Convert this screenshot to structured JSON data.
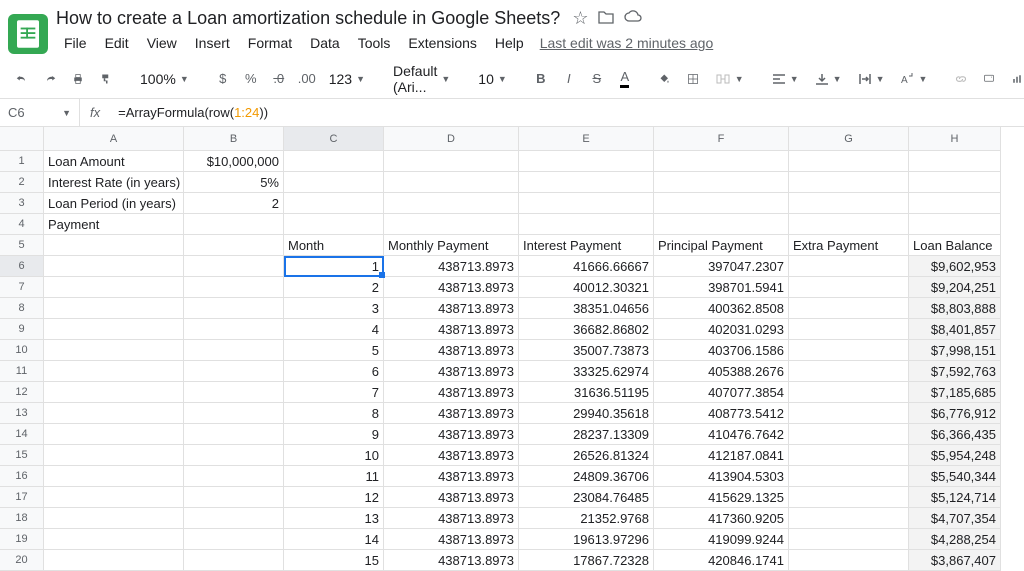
{
  "doc_title": "How to create a Loan amortization schedule in Google Sheets?",
  "menu": [
    "File",
    "Edit",
    "View",
    "Insert",
    "Format",
    "Data",
    "Tools",
    "Extensions",
    "Help"
  ],
  "last_edit": "Last edit was 2 minutes ago",
  "toolbar": {
    "zoom": "100%",
    "currency": "$",
    "percent": "%",
    "dec_dec": ".0",
    "inc_dec": ".00",
    "more_fmt": "123",
    "font": "Default (Ari...",
    "font_size": "10"
  },
  "name_box": "C6",
  "formula": {
    "prefix": "=ArrayFormula(row(",
    "range": "1:24",
    "suffix": "))"
  },
  "cols": [
    "A",
    "B",
    "C",
    "D",
    "E",
    "F",
    "G",
    "H"
  ],
  "rows": [
    {
      "n": "1",
      "A": "Loan Amount",
      "B": "$10,000,000",
      "Br": true
    },
    {
      "n": "2",
      "A": "Interest Rate (in years)",
      "B": "5%",
      "Br": true
    },
    {
      "n": "3",
      "A": "Loan Period (in years)",
      "B": "2",
      "Br": true
    },
    {
      "n": "4",
      "A": "Payment"
    },
    {
      "n": "5",
      "C": "Month",
      "D": "Monthly Payment",
      "E": "Interest Payment",
      "F": "Principal Payment",
      "G": "Extra Payment",
      "H": "Loan Balance"
    },
    {
      "n": "6",
      "C": "1",
      "D": "438713.8973",
      "E": "41666.66667",
      "F": "397047.2307",
      "H": "$9,602,953",
      "sel": true,
      "shade": true
    },
    {
      "n": "7",
      "C": "2",
      "D": "438713.8973",
      "E": "40012.30321",
      "F": "398701.5941",
      "H": "$9,204,251",
      "shade": true
    },
    {
      "n": "8",
      "C": "3",
      "D": "438713.8973",
      "E": "38351.04656",
      "F": "400362.8508",
      "H": "$8,803,888",
      "shade": true
    },
    {
      "n": "9",
      "C": "4",
      "D": "438713.8973",
      "E": "36682.86802",
      "F": "402031.0293",
      "H": "$8,401,857",
      "shade": true
    },
    {
      "n": "10",
      "C": "5",
      "D": "438713.8973",
      "E": "35007.73873",
      "F": "403706.1586",
      "H": "$7,998,151",
      "shade": true
    },
    {
      "n": "11",
      "C": "6",
      "D": "438713.8973",
      "E": "33325.62974",
      "F": "405388.2676",
      "H": "$7,592,763",
      "shade": true
    },
    {
      "n": "12",
      "C": "7",
      "D": "438713.8973",
      "E": "31636.51195",
      "F": "407077.3854",
      "H": "$7,185,685",
      "shade": true
    },
    {
      "n": "13",
      "C": "8",
      "D": "438713.8973",
      "E": "29940.35618",
      "F": "408773.5412",
      "H": "$6,776,912",
      "shade": true
    },
    {
      "n": "14",
      "C": "9",
      "D": "438713.8973",
      "E": "28237.13309",
      "F": "410476.7642",
      "H": "$6,366,435",
      "shade": true
    },
    {
      "n": "15",
      "C": "10",
      "D": "438713.8973",
      "E": "26526.81324",
      "F": "412187.0841",
      "H": "$5,954,248",
      "shade": true
    },
    {
      "n": "16",
      "C": "11",
      "D": "438713.8973",
      "E": "24809.36706",
      "F": "413904.5303",
      "H": "$5,540,344",
      "shade": true
    },
    {
      "n": "17",
      "C": "12",
      "D": "438713.8973",
      "E": "23084.76485",
      "F": "415629.1325",
      "H": "$5,124,714",
      "shade": true
    },
    {
      "n": "18",
      "C": "13",
      "D": "438713.8973",
      "E": "21352.9768",
      "F": "417360.9205",
      "H": "$4,707,354",
      "shade": true
    },
    {
      "n": "19",
      "C": "14",
      "D": "438713.8973",
      "E": "19613.97296",
      "F": "419099.9244",
      "H": "$4,288,254",
      "shade": true
    },
    {
      "n": "20",
      "C": "15",
      "D": "438713.8973",
      "E": "17867.72328",
      "F": "420846.1741",
      "H": "$3,867,407",
      "shade": true
    }
  ]
}
